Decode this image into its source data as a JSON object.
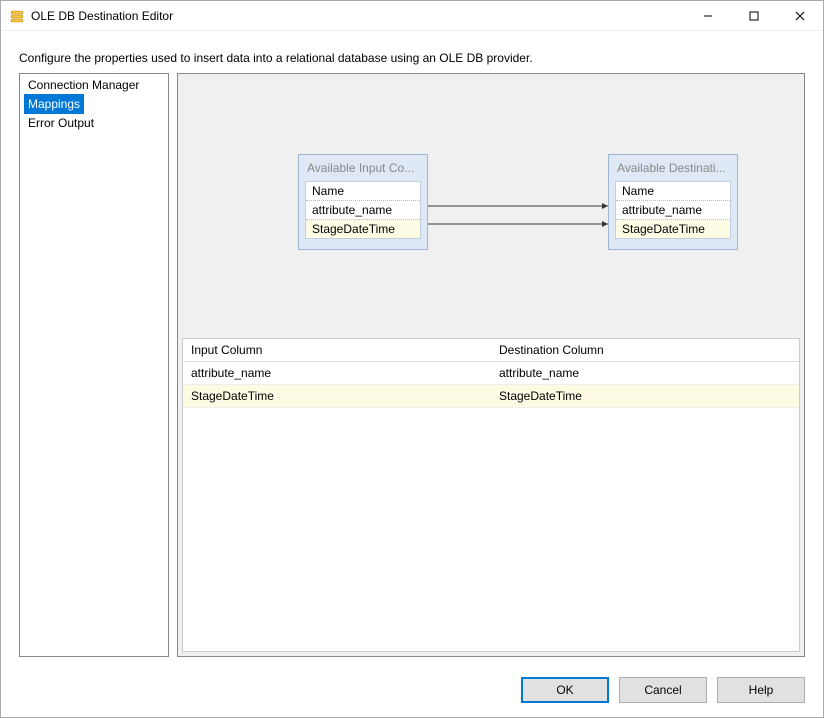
{
  "window": {
    "title": "OLE DB Destination Editor",
    "description": "Configure the properties used to insert data into a relational database using an OLE DB provider."
  },
  "sidebar": {
    "items": [
      {
        "label": "Connection Manager",
        "selected": false
      },
      {
        "label": "Mappings",
        "selected": true
      },
      {
        "label": "Error Output",
        "selected": false
      }
    ]
  },
  "diagram": {
    "input_box": {
      "title": "Available Input Co...",
      "columns": [
        "Name",
        "attribute_name",
        "StageDateTime"
      ]
    },
    "dest_box": {
      "title": "Available Destinati...",
      "columns": [
        "Name",
        "attribute_name",
        "StageDateTime"
      ]
    }
  },
  "grid": {
    "headers": {
      "input": "Input Column",
      "dest": "Destination Column"
    },
    "rows": [
      {
        "input": "attribute_name",
        "dest": "attribute_name",
        "hl": false
      },
      {
        "input": "StageDateTime",
        "dest": "StageDateTime",
        "hl": true
      }
    ]
  },
  "buttons": {
    "ok": "OK",
    "cancel": "Cancel",
    "help": "Help"
  }
}
